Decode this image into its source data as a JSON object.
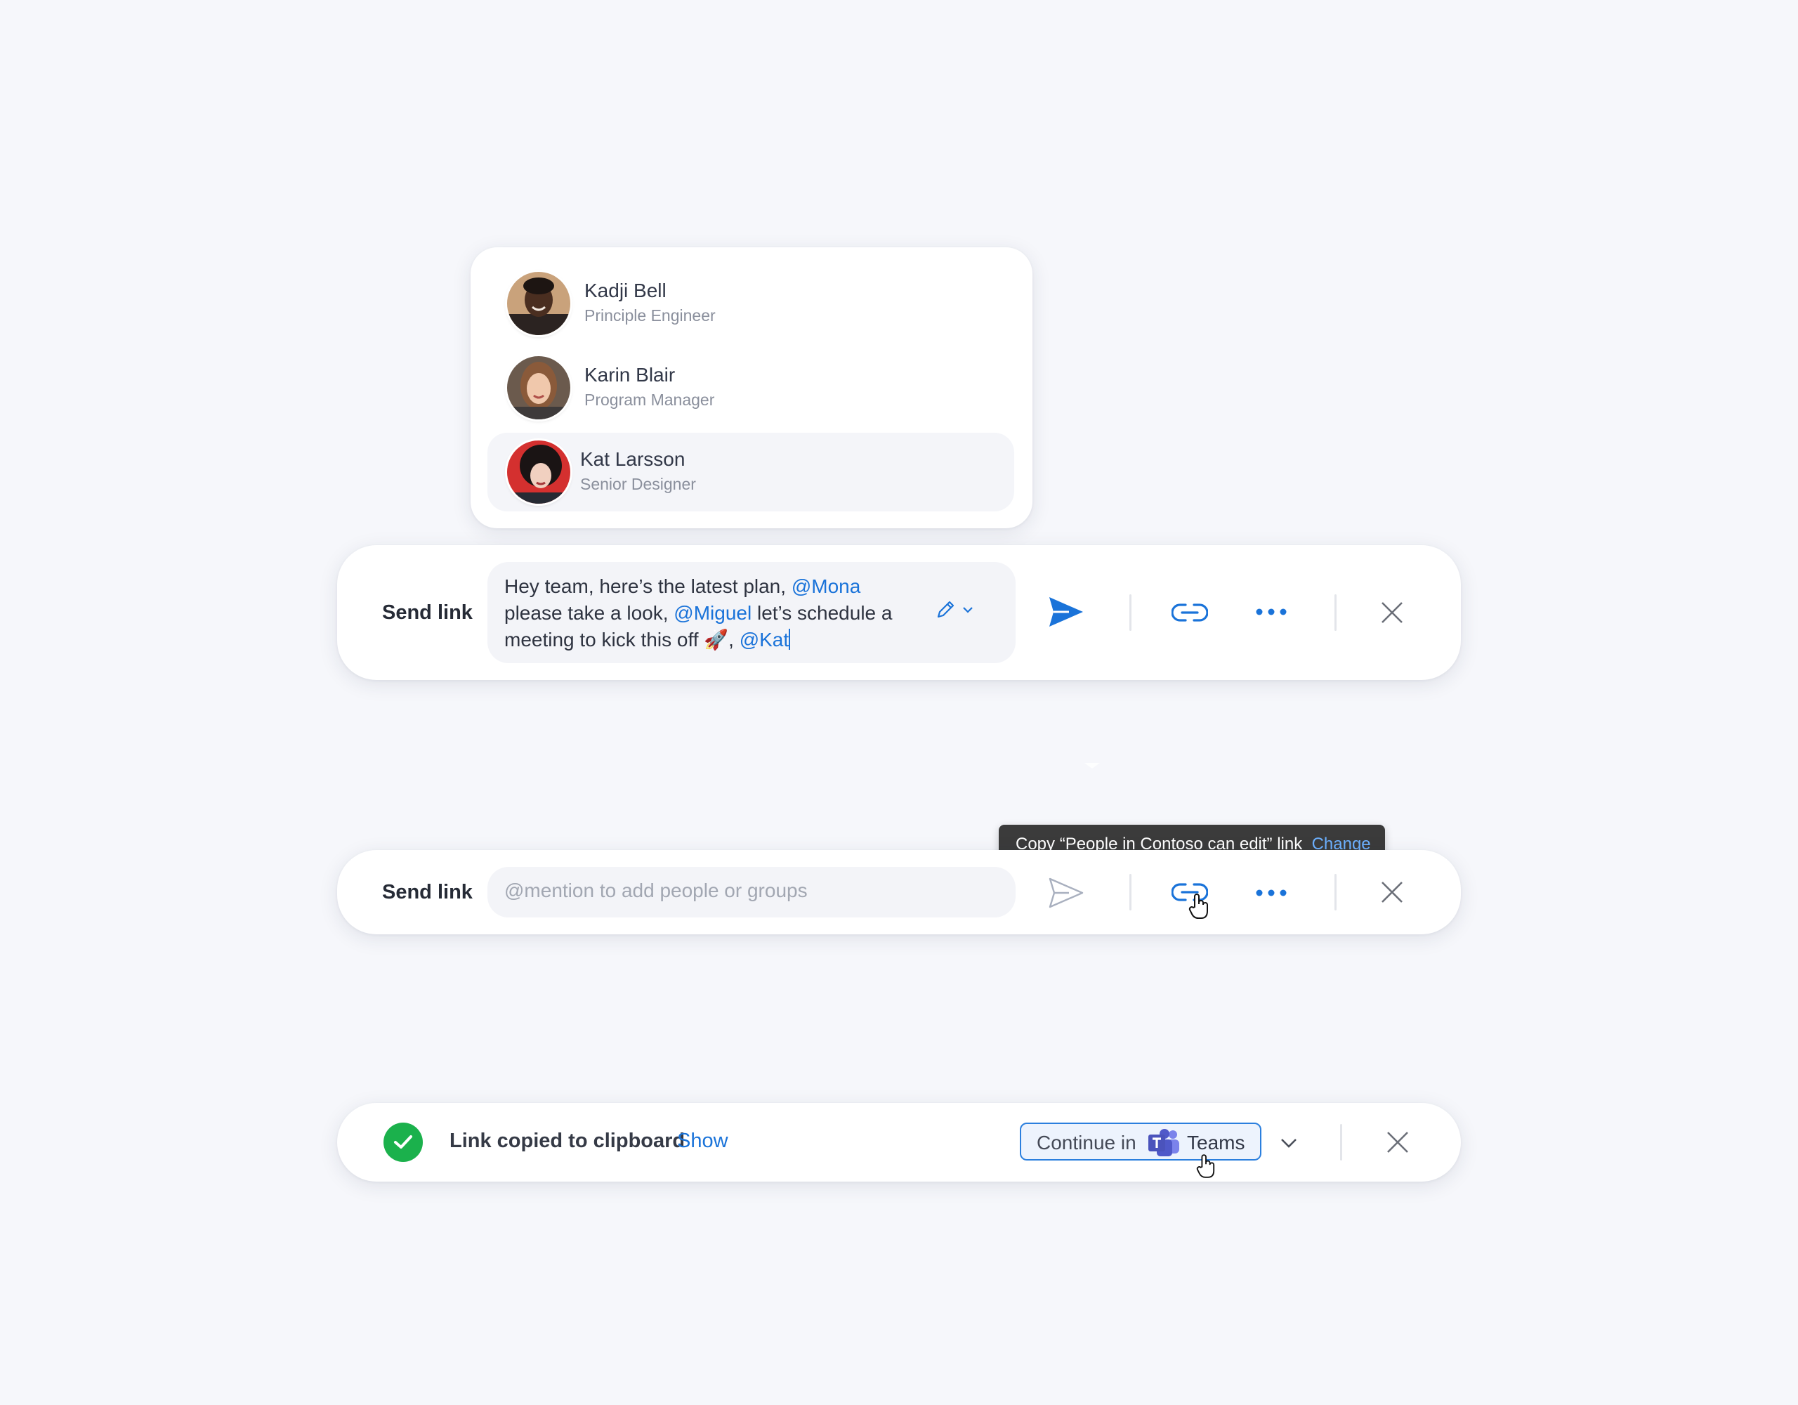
{
  "people_picker": {
    "people": [
      {
        "name": "Kadji Bell",
        "role": "Principle Engineer",
        "selected": false
      },
      {
        "name": "Karin Blair",
        "role": "Program Manager",
        "selected": false
      },
      {
        "name": "Kat Larsson",
        "role": "Senior Designer",
        "selected": true
      }
    ]
  },
  "compose_bar": {
    "label": "Send link",
    "message": {
      "line1_text": "Hey team, here’s the latest plan, ",
      "line1_mention": "@Mona",
      "line2_text": "please take a look, ",
      "line2_mention": "@Miguel",
      "line2_rest": " let’s schedule a",
      "line3_text": "meeting to kick this off 🚀, ",
      "line3_mention": "@Kat"
    },
    "icons": [
      "pencil-icon",
      "chevron-down-icon",
      "send-icon",
      "link-icon",
      "more-icon",
      "close-icon"
    ]
  },
  "empty_bar": {
    "label": "Send link",
    "placeholder": "@mention to add people or groups",
    "tooltip": {
      "text": "Copy “People in Contoso can edit” link",
      "link": "Change"
    }
  },
  "toast_bar": {
    "message": "Link copied to clipboard",
    "show_link": "Show",
    "continue_label": "Continue in",
    "app_name": "Teams"
  },
  "colors": {
    "accent": "#1a73d9",
    "success": "#1bb14c",
    "background": "#f6f7fb"
  }
}
